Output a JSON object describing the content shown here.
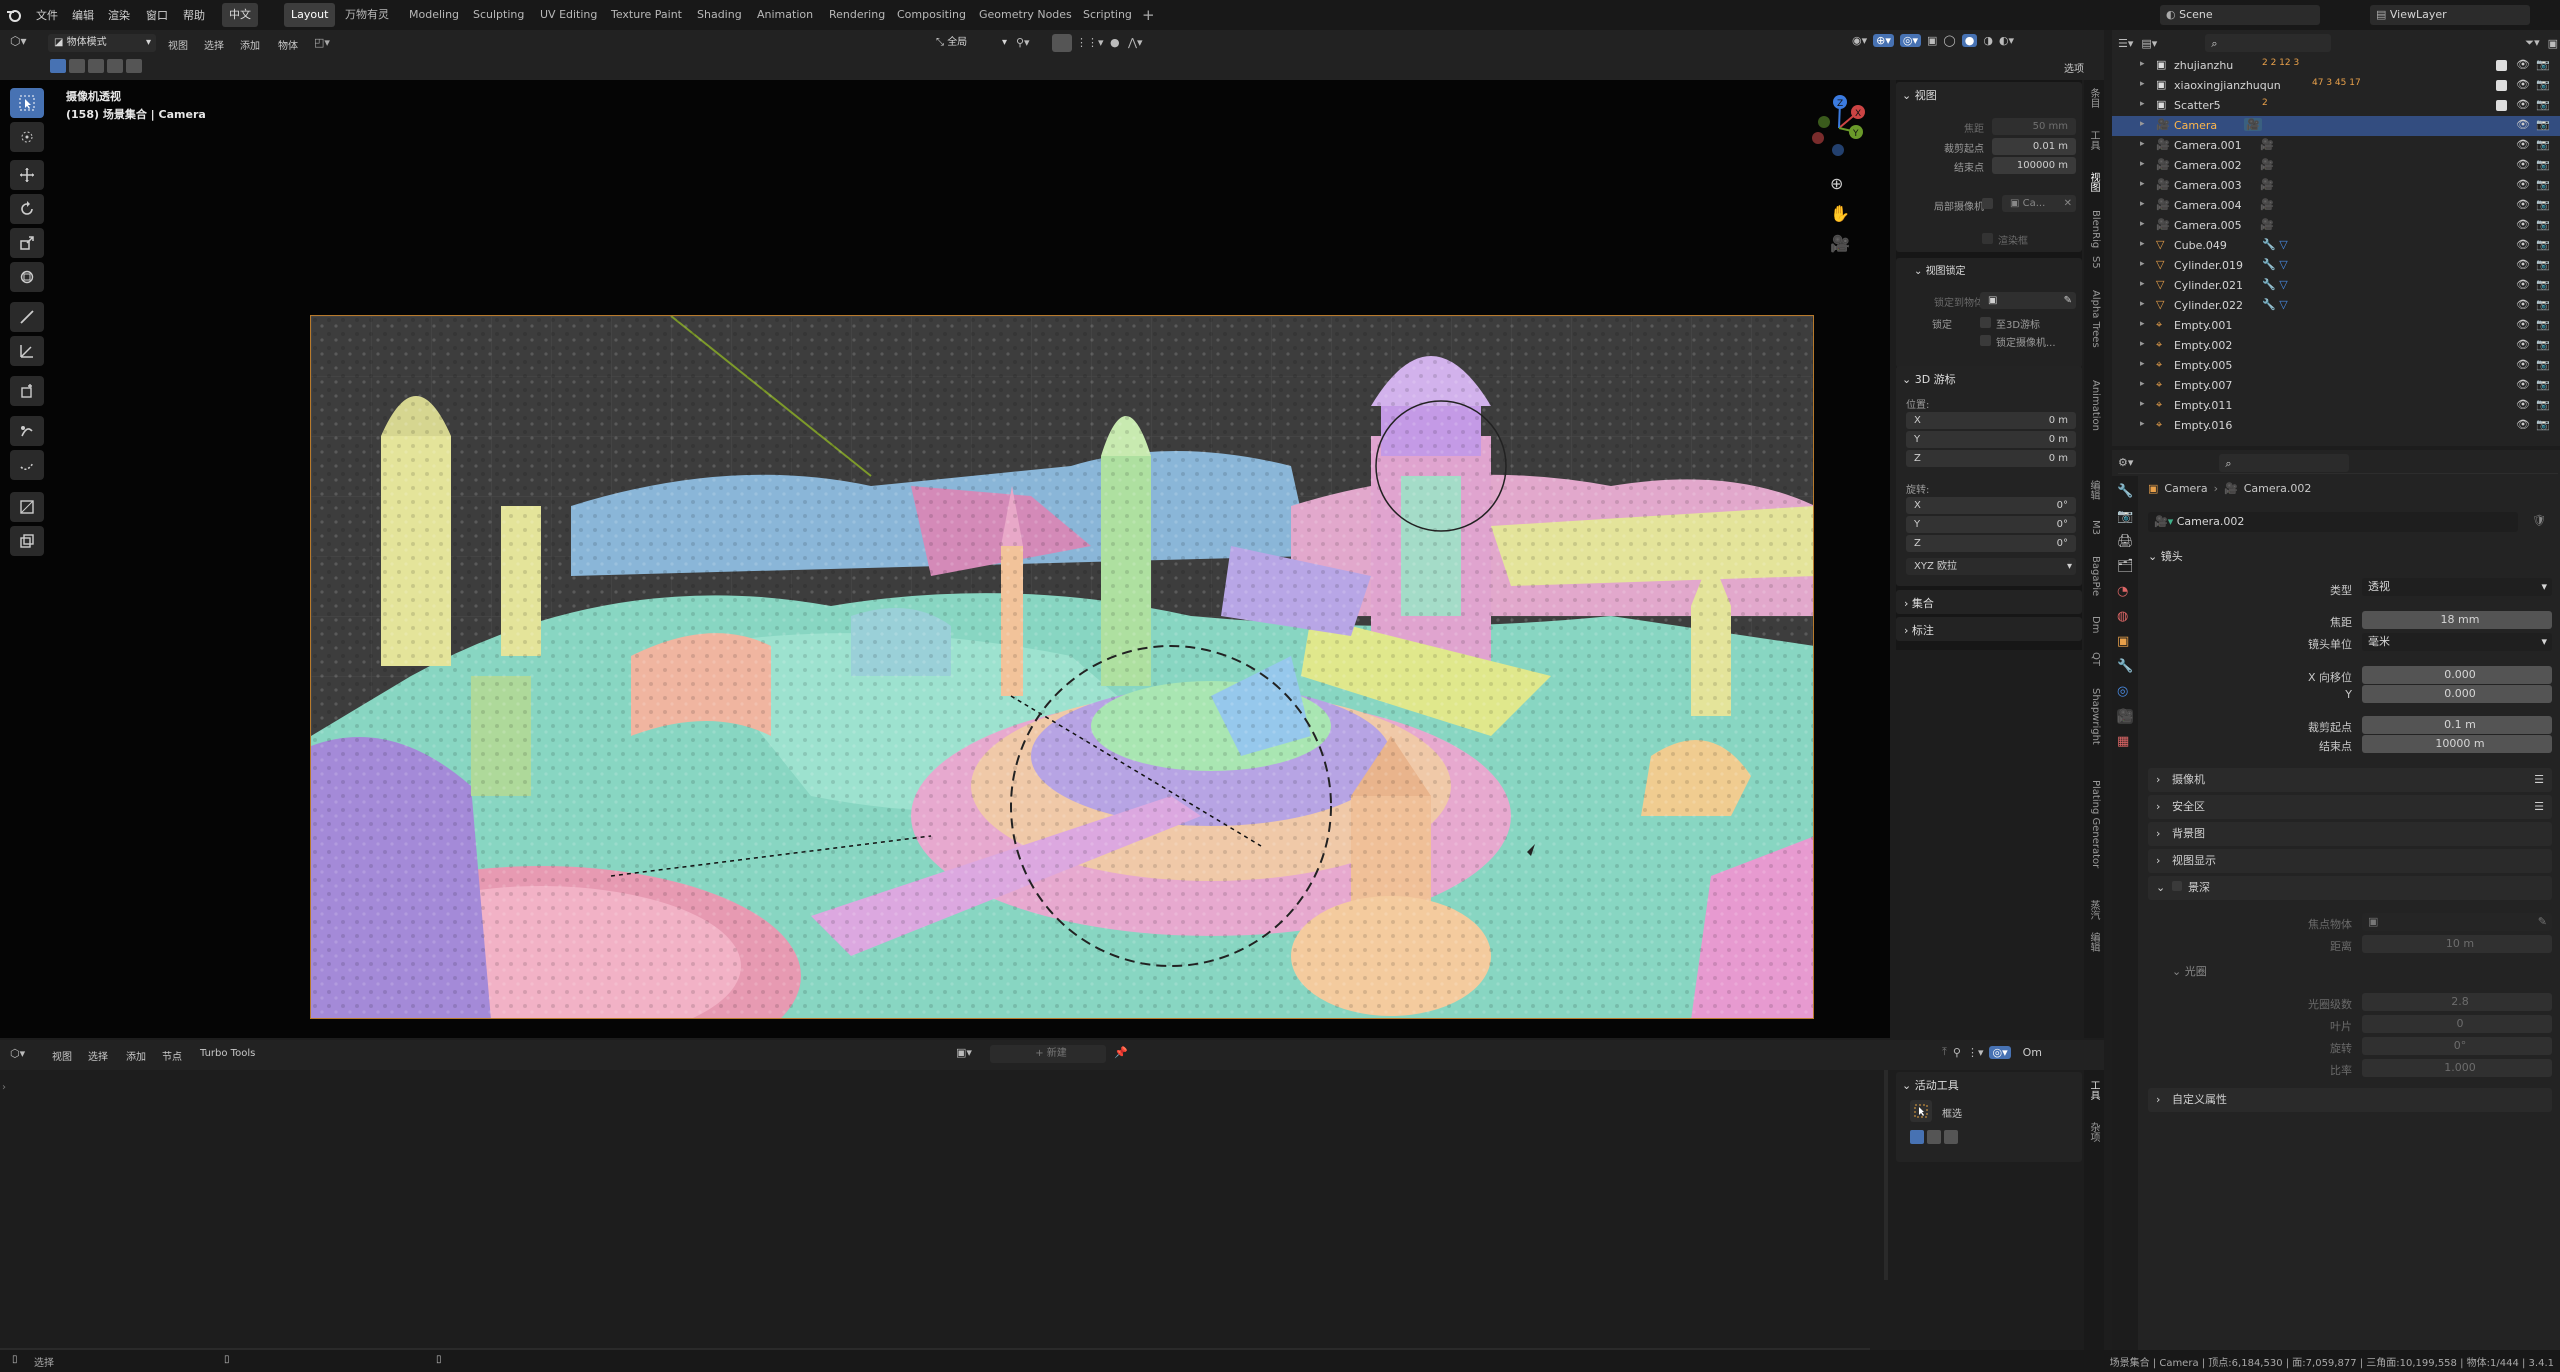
{
  "app": {
    "menu": [
      "文件",
      "编辑",
      "渲染",
      "窗口",
      "帮助",
      "中文"
    ],
    "workspaces": [
      "Layout",
      "万物有灵",
      "Modeling",
      "Sculpting",
      "UV Editing",
      "Texture Paint",
      "Shading",
      "Animation",
      "Rendering",
      "Compositing",
      "Geometry Nodes",
      "Scripting"
    ],
    "active_workspace": "Layout",
    "scene": "Scene",
    "view_layer": "ViewLayer"
  },
  "viewport": {
    "mode": "物体模式",
    "menu": [
      "视图",
      "选择",
      "添加",
      "物体"
    ],
    "transform_orientation": "全局",
    "options_label": "选项",
    "title": "摄像机透视",
    "subtitle": "(158) 场景集合 | Camera",
    "gizmo_axes": {
      "x": "X",
      "y": "Y",
      "z": "Z"
    }
  },
  "npanel": {
    "view": {
      "header": "视图",
      "focal_label": "焦距",
      "focal_value": "50 mm",
      "clip_start_label": "裁剪起点",
      "clip_start_value": "0.01 m",
      "clip_end_label": "结束点",
      "clip_end_value": "100000 m",
      "local_camera_label": "局部摄像机",
      "local_camera_value": "Ca...",
      "render_region_label": "渲染框",
      "view_lock_header": "视图锁定",
      "lock_obj_label": "锁定到物体",
      "lock_label": "锁定",
      "to_3d_cursor": "至3D游标",
      "lock_camera": "锁定摄像机..."
    },
    "cursor": {
      "header": "3D 游标",
      "location_label": "位置:",
      "loc": [
        {
          "axis": "X",
          "value": "0 m"
        },
        {
          "axis": "Y",
          "value": "0 m"
        },
        {
          "axis": "Z",
          "value": "0 m"
        }
      ],
      "rotation_label": "旋转:",
      "rot": [
        {
          "axis": "X",
          "value": "0°"
        },
        {
          "axis": "Y",
          "value": "0°"
        },
        {
          "axis": "Z",
          "value": "0°"
        }
      ],
      "rotation_mode": "XYZ 欧拉"
    },
    "collection_header": "集合",
    "annotation_header": "标注",
    "tabs": [
      "条目",
      "工具",
      "视图",
      "BlenRig",
      "S5",
      "Alpha Trees",
      "Animation",
      "编辑",
      "M3",
      "BagaPie",
      "Dm",
      "QT",
      "Shapwright",
      "Plating Generator",
      "蒸汽",
      "编辑"
    ]
  },
  "outliner": {
    "rows": [
      {
        "name": "zhujianzhu",
        "type": "collection",
        "extra": "2 2 12 3"
      },
      {
        "name": "xiaoxingjianzhuqun",
        "type": "collection",
        "extra": "47 3 45 17"
      },
      {
        "name": "Scatter5",
        "type": "collection",
        "extra": "2"
      },
      {
        "name": "Camera",
        "type": "camera",
        "selected": true
      },
      {
        "name": "Camera.001",
        "type": "camera"
      },
      {
        "name": "Camera.002",
        "type": "camera"
      },
      {
        "name": "Camera.003",
        "type": "camera"
      },
      {
        "name": "Camera.004",
        "type": "camera"
      },
      {
        "name": "Camera.005",
        "type": "camera"
      },
      {
        "name": "Cube.049",
        "type": "mesh"
      },
      {
        "name": "Cylinder.019",
        "type": "mesh"
      },
      {
        "name": "Cylinder.021",
        "type": "mesh"
      },
      {
        "name": "Cylinder.022",
        "type": "mesh"
      },
      {
        "name": "Empty.001",
        "type": "empty"
      },
      {
        "name": "Empty.002",
        "type": "empty"
      },
      {
        "name": "Empty.005",
        "type": "empty"
      },
      {
        "name": "Empty.007",
        "type": "empty"
      },
      {
        "name": "Empty.011",
        "type": "empty"
      },
      {
        "name": "Empty.016",
        "type": "empty"
      }
    ]
  },
  "properties": {
    "breadcrumb": [
      "Camera",
      "Camera.002"
    ],
    "data_name": "Camera.002",
    "lens_header": "镜头",
    "type_label": "类型",
    "type_value": "透视",
    "focal_label": "焦距",
    "focal_value": "18 mm",
    "lens_unit_label": "镜头单位",
    "lens_unit_value": "毫米",
    "shift_x_label": "X 向移位",
    "shift_x_value": "0.000",
    "shift_y_label": "Y",
    "shift_y_value": "0.000",
    "clip_start_label": "裁剪起点",
    "clip_start_value": "0.1 m",
    "clip_end_label": "结束点",
    "clip_end_value": "10000 m",
    "sections": [
      "摄像机",
      "安全区",
      "背景图",
      "视图显示"
    ],
    "dof_header": "景深",
    "focus_obj_label": "焦点物体",
    "distance_label": "距离",
    "distance_value": "10 m",
    "aperture_header": "光圈",
    "fstop_label": "光圈级数",
    "fstop_value": "2.8",
    "blades_label": "叶片",
    "blades_value": "0",
    "rotation_label": "旋转",
    "rotation_value": "0°",
    "ratio_label": "比率",
    "ratio_value": "1.000",
    "custom_props": "自定义属性"
  },
  "node_editor": {
    "menu": [
      "视图",
      "选择",
      "添加",
      "节点",
      "Turbo Tools"
    ],
    "new_label": "新建",
    "right_label": "Om",
    "active_tool_header": "活动工具",
    "active_tool_name": "框选",
    "tabs": [
      "工具",
      "杂项"
    ]
  },
  "status": {
    "left": "选择",
    "right": "场景集合 | Camera | 顶点:6,184,530 | 面:7,059,877 | 三角面:10,199,558 | 物体:1/444 | 3.4.1"
  }
}
